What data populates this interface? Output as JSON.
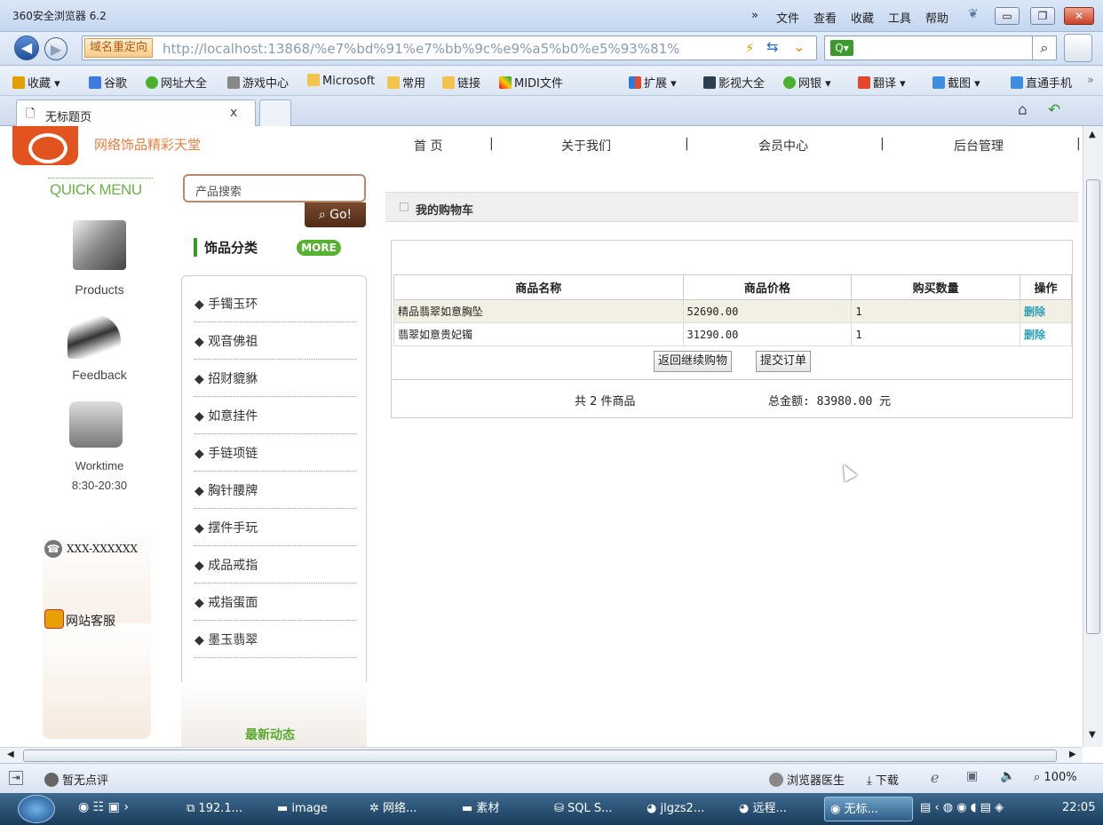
{
  "window": {
    "title": "360安全浏览器 6.2",
    "menu_chevron": "»",
    "menu": [
      "文件",
      "查看",
      "收藏",
      "工具",
      "帮助"
    ]
  },
  "address": {
    "redirect_label": "域名重定向",
    "url": "http://localhost:13868/%e7%bd%91%e7%bb%9c%e9%a5%b0%e5%93%81%"
  },
  "favorites": [
    "收藏",
    "谷歌",
    "网址大全",
    "游戏中心",
    "Microsoft",
    "常用",
    "链接",
    "MIDI文件",
    "扩展",
    "影视大全",
    "网银",
    "翻译",
    "截图",
    "直通手机"
  ],
  "favorites_more": "»",
  "tab": {
    "title": "无标题页",
    "close": "x"
  },
  "site": {
    "name": "网络饰品精彩天堂",
    "nav": [
      "首 页",
      "关于我们",
      "会员中心",
      "后台管理"
    ],
    "nav_sep": "|",
    "quick_menu": "QUICK MENU",
    "quick_items": [
      "Products",
      "Feedback",
      "Worktime"
    ],
    "worktime_hours": "8:30-20:30",
    "phone": "XXX-XXXXXX",
    "customer_service": "网站客服",
    "search_placeholder": "产品搜索",
    "go_label": "Go!",
    "category_title": "饰品分类",
    "more_label": "MORE",
    "category_bullet": "◆",
    "categories": [
      "手镯玉环",
      "观音佛祖",
      "招财貔貅",
      "如意挂件",
      "手链项链",
      "胸针腰牌",
      "摆件手玩",
      "成品戒指",
      "戒指蛋面",
      "墨玉翡翠"
    ],
    "latest_news": "最新动态"
  },
  "cart": {
    "title": "我的购物车",
    "headers": [
      "商品名称",
      "商品价格",
      "购买数量",
      "操作"
    ],
    "rows": [
      {
        "name": "精品翡翠如意胸坠",
        "price": "52690.00",
        "qty": "1",
        "action": "删除"
      },
      {
        "name": "翡翠如意贵妃镯",
        "price": "31290.00",
        "qty": "1",
        "action": "删除"
      }
    ],
    "continue_btn": "返回继续购物",
    "submit_btn": "提交订单",
    "count_text": "共 2 件商品",
    "total_text": "总金额: 83980.00 元"
  },
  "statusbar": {
    "comment": "暂无点评",
    "doctor": "浏览器医生",
    "download": "下载",
    "zoom": "100%"
  },
  "taskbar": {
    "tasks": [
      "192.1...",
      "image",
      "网络...",
      "素材",
      "SQL S...",
      "jlgzs2...",
      "远程...",
      "无标..."
    ],
    "time": "22:05"
  },
  "colors": {
    "accent_orange": "#e2531f",
    "green": "#58b232",
    "delete_link": "#2a9fb7"
  }
}
